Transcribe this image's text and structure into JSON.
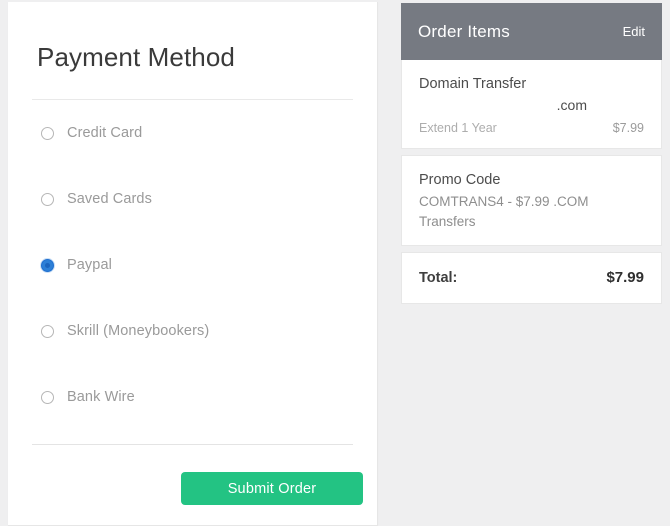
{
  "payment": {
    "title": "Payment Method",
    "methods": [
      {
        "label": "Credit Card",
        "selected": false
      },
      {
        "label": "Saved Cards",
        "selected": false
      },
      {
        "label": "Paypal",
        "selected": true
      },
      {
        "label": "Skrill (Moneybookers)",
        "selected": false
      },
      {
        "label": "Bank Wire",
        "selected": false
      }
    ],
    "submit_label": "Submit Order",
    "submit_color": "#23c383"
  },
  "order": {
    "header_title": "Order Items",
    "edit_label": "Edit",
    "header_color": "#767a82",
    "items": [
      {
        "title": "Domain Transfer",
        "domain": ".com",
        "term": "Extend 1 Year",
        "price": "$7.99"
      },
      {
        "title": "Promo Code",
        "description": "COMTRANS4 - $7.99 .COM Transfers"
      }
    ],
    "total_label": "Total:",
    "total_value": "$7.99"
  }
}
